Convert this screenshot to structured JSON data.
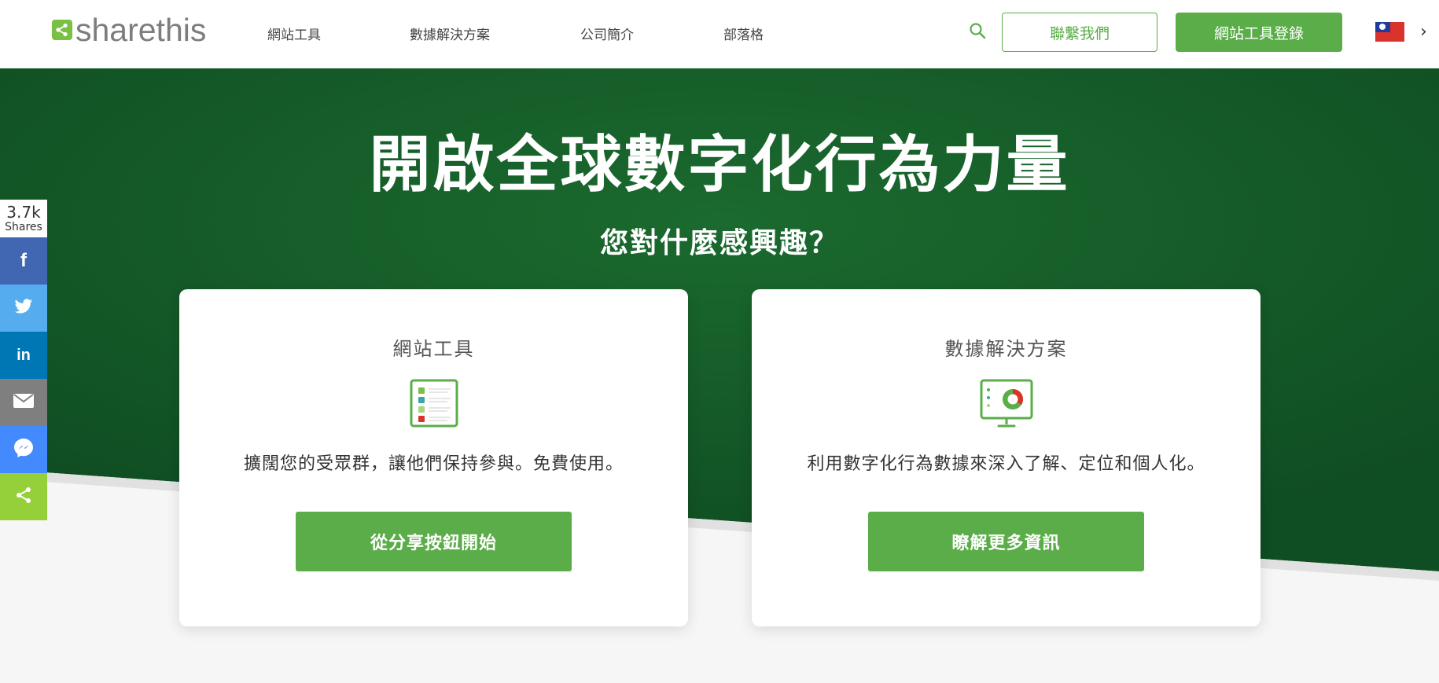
{
  "header": {
    "logo_text": "sharethis",
    "nav": [
      "網站工具",
      "數據解決方案",
      "公司簡介",
      "部落格"
    ],
    "contact_label": "聯繫我們",
    "login_label": "網站工具登錄",
    "colors": {
      "brand_green": "#5aad49",
      "logo_green": "#7ac043"
    }
  },
  "hero": {
    "title": "開啟全球數字化行為力量",
    "subtitle": "您對什麼感興趣？",
    "colors": {
      "bg_dark": "#0f4d22",
      "bg_light": "#1a6b2e"
    }
  },
  "cards": [
    {
      "title": "網站工具",
      "icon": "list-icon",
      "description": "擴闊您的受眾群，讓他們保持參與。免費使用。",
      "button": "從分享按鈕開始"
    },
    {
      "title": "數據解決方案",
      "icon": "monitor-chart-icon",
      "description": "利用數字化行為數據來深入了解、定位和個人化。",
      "button": "瞭解更多資訊"
    }
  ],
  "share_bar": {
    "count": "3.7k",
    "count_label": "Shares",
    "buttons": [
      {
        "name": "facebook",
        "glyph": "f",
        "color": "#4267b2"
      },
      {
        "name": "twitter",
        "glyph": "twitter-bird",
        "color": "#55acee"
      },
      {
        "name": "linkedin",
        "glyph": "in",
        "color": "#0077b5"
      },
      {
        "name": "email",
        "glyph": "envelope",
        "color": "#7f7f7f"
      },
      {
        "name": "messenger",
        "glyph": "messenger",
        "color": "#448aff"
      },
      {
        "name": "sharethis",
        "glyph": "share",
        "color": "#95d03a"
      }
    ]
  }
}
